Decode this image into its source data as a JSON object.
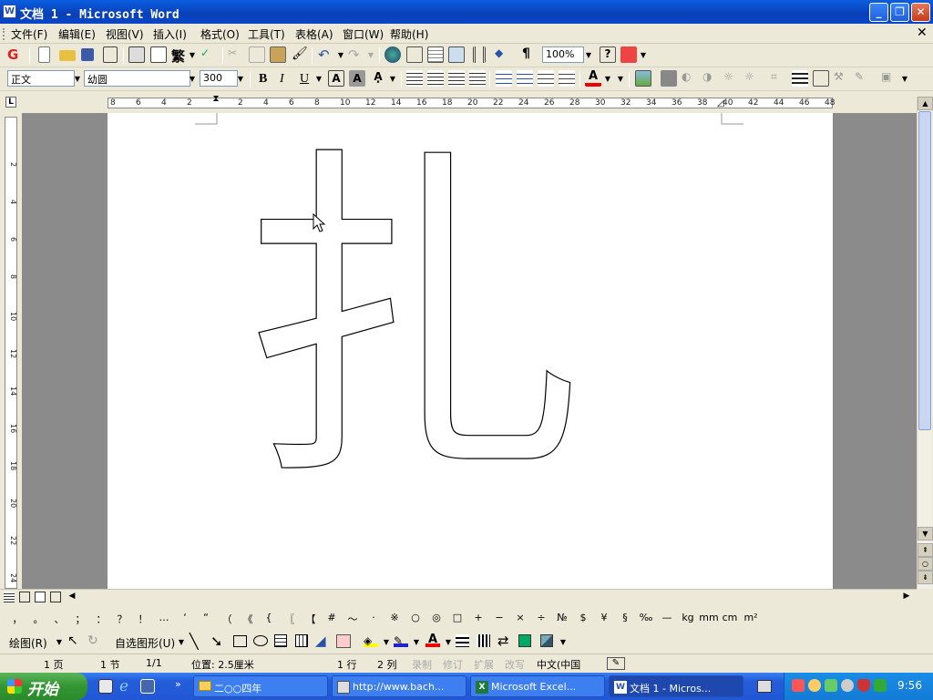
{
  "window": {
    "title": "文档 1 - Microsoft Word"
  },
  "menu": [
    "文件(F)",
    "编辑(E)",
    "视图(V)",
    "插入(I)",
    "格式(O)",
    "工具(T)",
    "表格(A)",
    "窗口(W)",
    "帮助(H)"
  ],
  "toolbar": {
    "zoom": "100%",
    "traditional_label": "繁"
  },
  "format": {
    "style": "正文",
    "font": "幼圆",
    "size": "300",
    "bold": "B",
    "italic": "I",
    "underline": "U"
  },
  "ruler_h": [
    "8",
    "6",
    "4",
    "2",
    "2",
    "4",
    "6",
    "8",
    "10",
    "12",
    "14",
    "16",
    "18",
    "20",
    "22",
    "24",
    "26",
    "28",
    "30",
    "32",
    "34",
    "36",
    "38",
    "40",
    "42",
    "44",
    "46",
    "48"
  ],
  "ruler_v": [
    "2",
    "4",
    "6",
    "8",
    "10",
    "12",
    "14",
    "16",
    "18",
    "20",
    "22",
    "24"
  ],
  "document": {
    "text": "扎"
  },
  "symbols": [
    "，",
    "。",
    "、",
    "；",
    "：",
    "？",
    "！",
    "…",
    "‘",
    "“",
    "（",
    "《",
    "{",
    "〖",
    "【",
    "#",
    "～",
    "·",
    "※",
    "○",
    "◎",
    "□",
    "+",
    "−",
    "×",
    "÷",
    "№",
    "$",
    "¥",
    "§",
    "‰",
    "—",
    "kg",
    "mm",
    "cm",
    "m²"
  ],
  "drawing": {
    "draw_label": "绘图(R)",
    "autoshapes_label": "自选图形(U)"
  },
  "status": {
    "page": "1 页",
    "section": "1 节",
    "pages": "1/1",
    "position": "位置: 2.5厘米",
    "line": "1 行",
    "col": "2 列",
    "rec": "录制",
    "trk": "修订",
    "ext": "扩展",
    "ovr": "改写",
    "lang": "中文(中国"
  },
  "taskbar": {
    "start": "开始",
    "tasks": [
      "二○○四年",
      "http://www.bach...",
      "Microsoft Excel...",
      "文档 1 - Micros..."
    ],
    "clock": "9:56"
  }
}
